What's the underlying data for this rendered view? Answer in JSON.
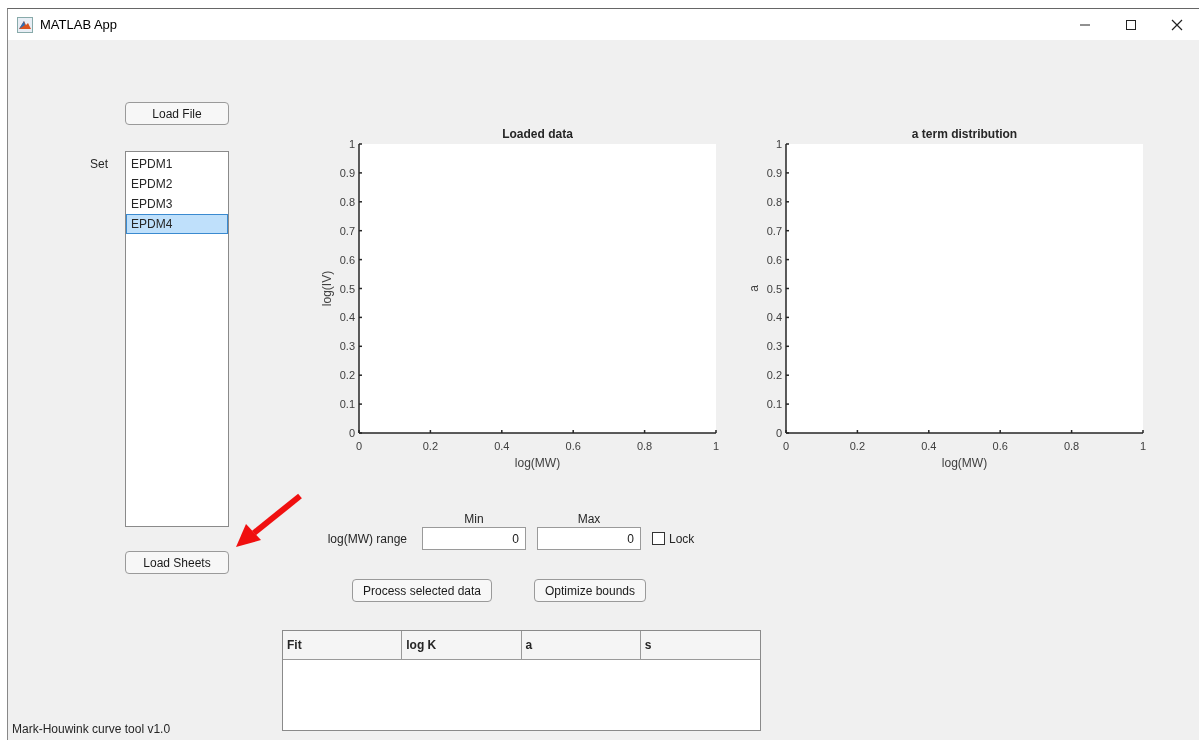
{
  "window": {
    "title": "MATLAB App"
  },
  "load_file_button": "Load File",
  "set_list": {
    "label": "Set",
    "items": [
      {
        "label": "EPDM1",
        "selected": false
      },
      {
        "label": "EPDM2",
        "selected": false
      },
      {
        "label": "EPDM3",
        "selected": false
      },
      {
        "label": "EPDM4",
        "selected": true
      }
    ]
  },
  "load_sheets_button": "Load Sheets",
  "charts": [
    {
      "chart_data": {
        "type": "line",
        "title": "Loaded data",
        "xlabel": "log(MW)",
        "ylabel": "log(IV)",
        "xlim": [
          0,
          1
        ],
        "ylim": [
          0,
          1
        ],
        "xticks": [
          0,
          0.2,
          0.4,
          0.6,
          0.8,
          1
        ],
        "yticks": [
          0,
          0.1,
          0.2,
          0.3,
          0.4,
          0.5,
          0.6,
          0.7,
          0.8,
          0.9,
          1
        ]
      }
    },
    {
      "chart_data": {
        "type": "line",
        "title": "a term distribution",
        "xlabel": "log(MW)",
        "ylabel": "a",
        "xlim": [
          0,
          1
        ],
        "ylim": [
          0,
          1
        ],
        "xticks": [
          0,
          0.2,
          0.4,
          0.6,
          0.8,
          1
        ],
        "yticks": [
          0,
          0.1,
          0.2,
          0.3,
          0.4,
          0.5,
          0.6,
          0.7,
          0.8,
          0.9,
          1
        ]
      }
    }
  ],
  "range": {
    "label": "log(MW) range",
    "min_label": "Min",
    "max_label": "Max",
    "min_value": "0",
    "max_value": "0",
    "lock": {
      "label": "Lock",
      "checked": false
    }
  },
  "buttons": [
    "Process selected data",
    "Optimize bounds"
  ],
  "table": {
    "columns": [
      "Fit",
      "log K",
      "a",
      "s"
    ]
  },
  "status_text": "Mark-Houwink curve tool v1.0"
}
